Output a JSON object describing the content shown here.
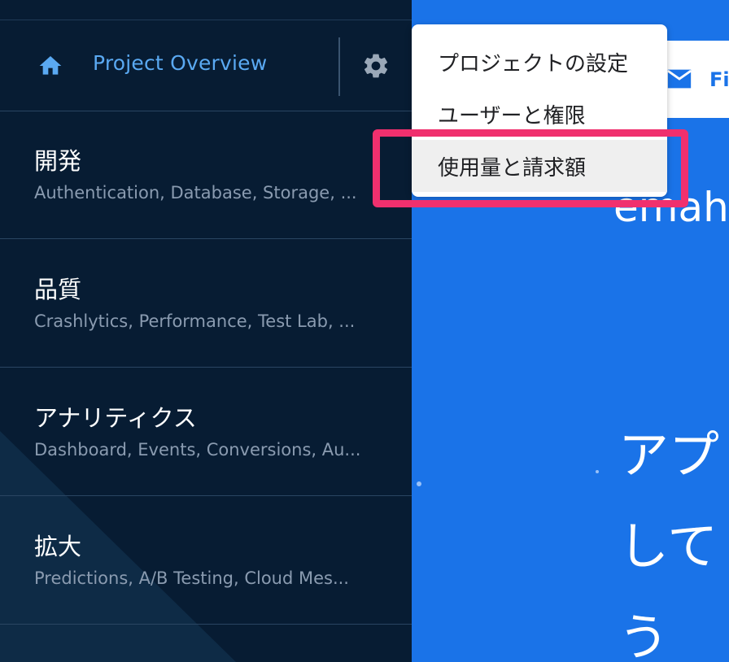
{
  "header": {
    "project_title": "Project Overview"
  },
  "sections": [
    {
      "title": "開発",
      "subtitle": "Authentication, Database, Storage, ..."
    },
    {
      "title": "品質",
      "subtitle": "Crashlytics, Performance, Test Lab, ..."
    },
    {
      "title": "アナリティクス",
      "subtitle": "Dashboard, Events, Conversions, Au..."
    },
    {
      "title": "拡大",
      "subtitle": "Predictions, A/B Testing, Cloud Mes..."
    }
  ],
  "menu": {
    "items": [
      {
        "label": "プロジェクトの設定"
      },
      {
        "label": "ユーザーと権限"
      },
      {
        "label": "使用量と請求額"
      }
    ]
  },
  "main": {
    "card_text": "Fi",
    "big_word": "emah",
    "hero_lines": [
      "アプ",
      "して",
      "う"
    ]
  },
  "colors": {
    "sidebar_bg": "#071c33",
    "main_bg": "#1a73e8",
    "accent_blue": "#5aa9f2",
    "highlight_pink": "#f0306e"
  },
  "icons": [
    "home-icon",
    "gear-icon",
    "mail-icon"
  ]
}
